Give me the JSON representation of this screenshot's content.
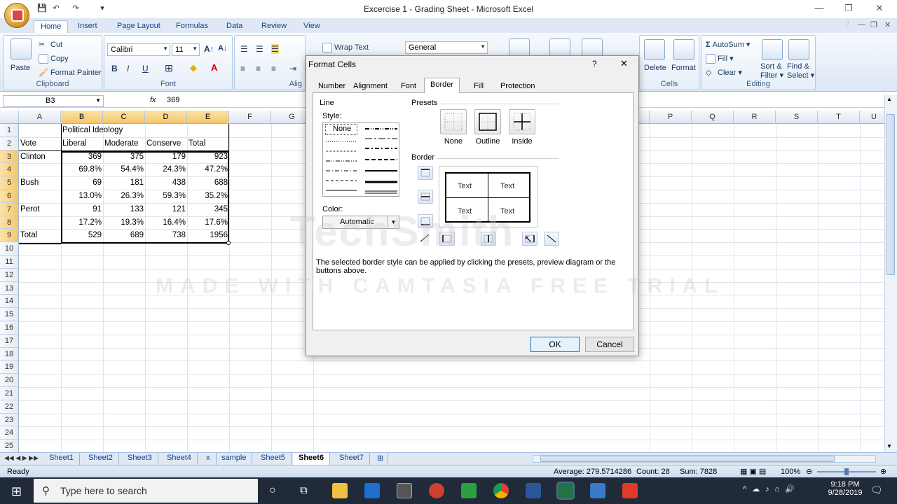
{
  "window": {
    "title": "Excercise 1 - Grading Sheet - Microsoft Excel"
  },
  "ribbon_tabs": [
    "Home",
    "Insert",
    "Page Layout",
    "Formulas",
    "Data",
    "Review",
    "View"
  ],
  "clipboard": {
    "paste": "Paste",
    "cut": "Cut",
    "copy": "Copy",
    "format_painter": "Format Painter",
    "label": "Clipboard"
  },
  "font": {
    "name": "Calibri",
    "size": "11",
    "label": "Font",
    "bold": "B",
    "italic": "I",
    "underline": "U"
  },
  "alignment": {
    "wrap_text": "Wrap Text",
    "label": "Alig"
  },
  "number": {
    "format": "General"
  },
  "cells_group": {
    "delete": "Delete",
    "format": "Format",
    "label": "Cells"
  },
  "editing": {
    "autosum": "AutoSum",
    "fill": "Fill",
    "clear": "Clear",
    "sort": "Sort &",
    "filter": "Filter",
    "find": "Find &",
    "select": "Select",
    "label": "Editing"
  },
  "formula_bar": {
    "name_box": "B3",
    "fx": "fx",
    "value": "369"
  },
  "columns": [
    "A",
    "B",
    "C",
    "D",
    "E",
    "F",
    "G",
    "P",
    "Q",
    "R",
    "S",
    "T",
    "U"
  ],
  "rows": [
    "1",
    "2",
    "3",
    "4",
    "5",
    "6",
    "7",
    "8",
    "9",
    "10",
    "11",
    "12",
    "13",
    "14",
    "15",
    "16",
    "17",
    "18",
    "19",
    "20",
    "21",
    "22",
    "23",
    "24",
    "25"
  ],
  "cells": {
    "b1": "Political Ideology",
    "a2": "Vote",
    "b2": "Liberal",
    "c2": "Moderate",
    "d2": "Conserve",
    "e2": "Total",
    "a3": "Clinton",
    "b3": "369",
    "c3": "375",
    "d3": "179",
    "e3": "923",
    "b4": "69.8%",
    "c4": "54.4%",
    "d4": "24.3%",
    "e4": "47.2%",
    "a5": "Bush",
    "b5": "69",
    "c5": "181",
    "d5": "438",
    "e5": "688",
    "b6": "13.0%",
    "c6": "26.3%",
    "d6": "59.3%",
    "e6": "35.2%",
    "a7": "Perot",
    "b7": "91",
    "c7": "133",
    "d7": "121",
    "e7": "345",
    "b8": "17.2%",
    "c8": "19.3%",
    "d8": "16.4%",
    "e8": "17.6%",
    "a9": "Total",
    "b9": "529",
    "c9": "689",
    "d9": "738",
    "e9": "1956"
  },
  "sheet_tabs": [
    "Sheet1",
    "Sheet2",
    "Sheet3",
    "Sheet4",
    "x",
    "sample",
    "Sheet5",
    "Sheet6",
    "Sheet7"
  ],
  "status": {
    "ready": "Ready",
    "average": "Average: 279.5714286",
    "count": "Count: 28",
    "sum": "Sum: 7828",
    "zoom": "100%"
  },
  "taskbar": {
    "search_placeholder": "Type here to search",
    "time": "9:18 PM",
    "date": "9/28/2019"
  },
  "dialog": {
    "title": "Format Cells",
    "help": "?",
    "close": "✕",
    "tabs": [
      "Number",
      "Alignment",
      "Font",
      "Border",
      "Fill",
      "Protection"
    ],
    "line_label": "Line",
    "style_label": "Style:",
    "style_none": "None",
    "color_label": "Color:",
    "color_value": "Automatic",
    "presets_label": "Presets",
    "preset_none": "None",
    "preset_outline": "Outline",
    "preset_inside": "Inside",
    "border_label": "Border",
    "preview_text": "Text",
    "hint": "The selected border style can be applied by clicking the presets, preview diagram or the buttons above.",
    "ok": "OK",
    "cancel": "Cancel"
  },
  "watermark": {
    "brand": "TechSmith",
    "trial": "MADE WITH CAMTASIA FREE TRIAL"
  }
}
